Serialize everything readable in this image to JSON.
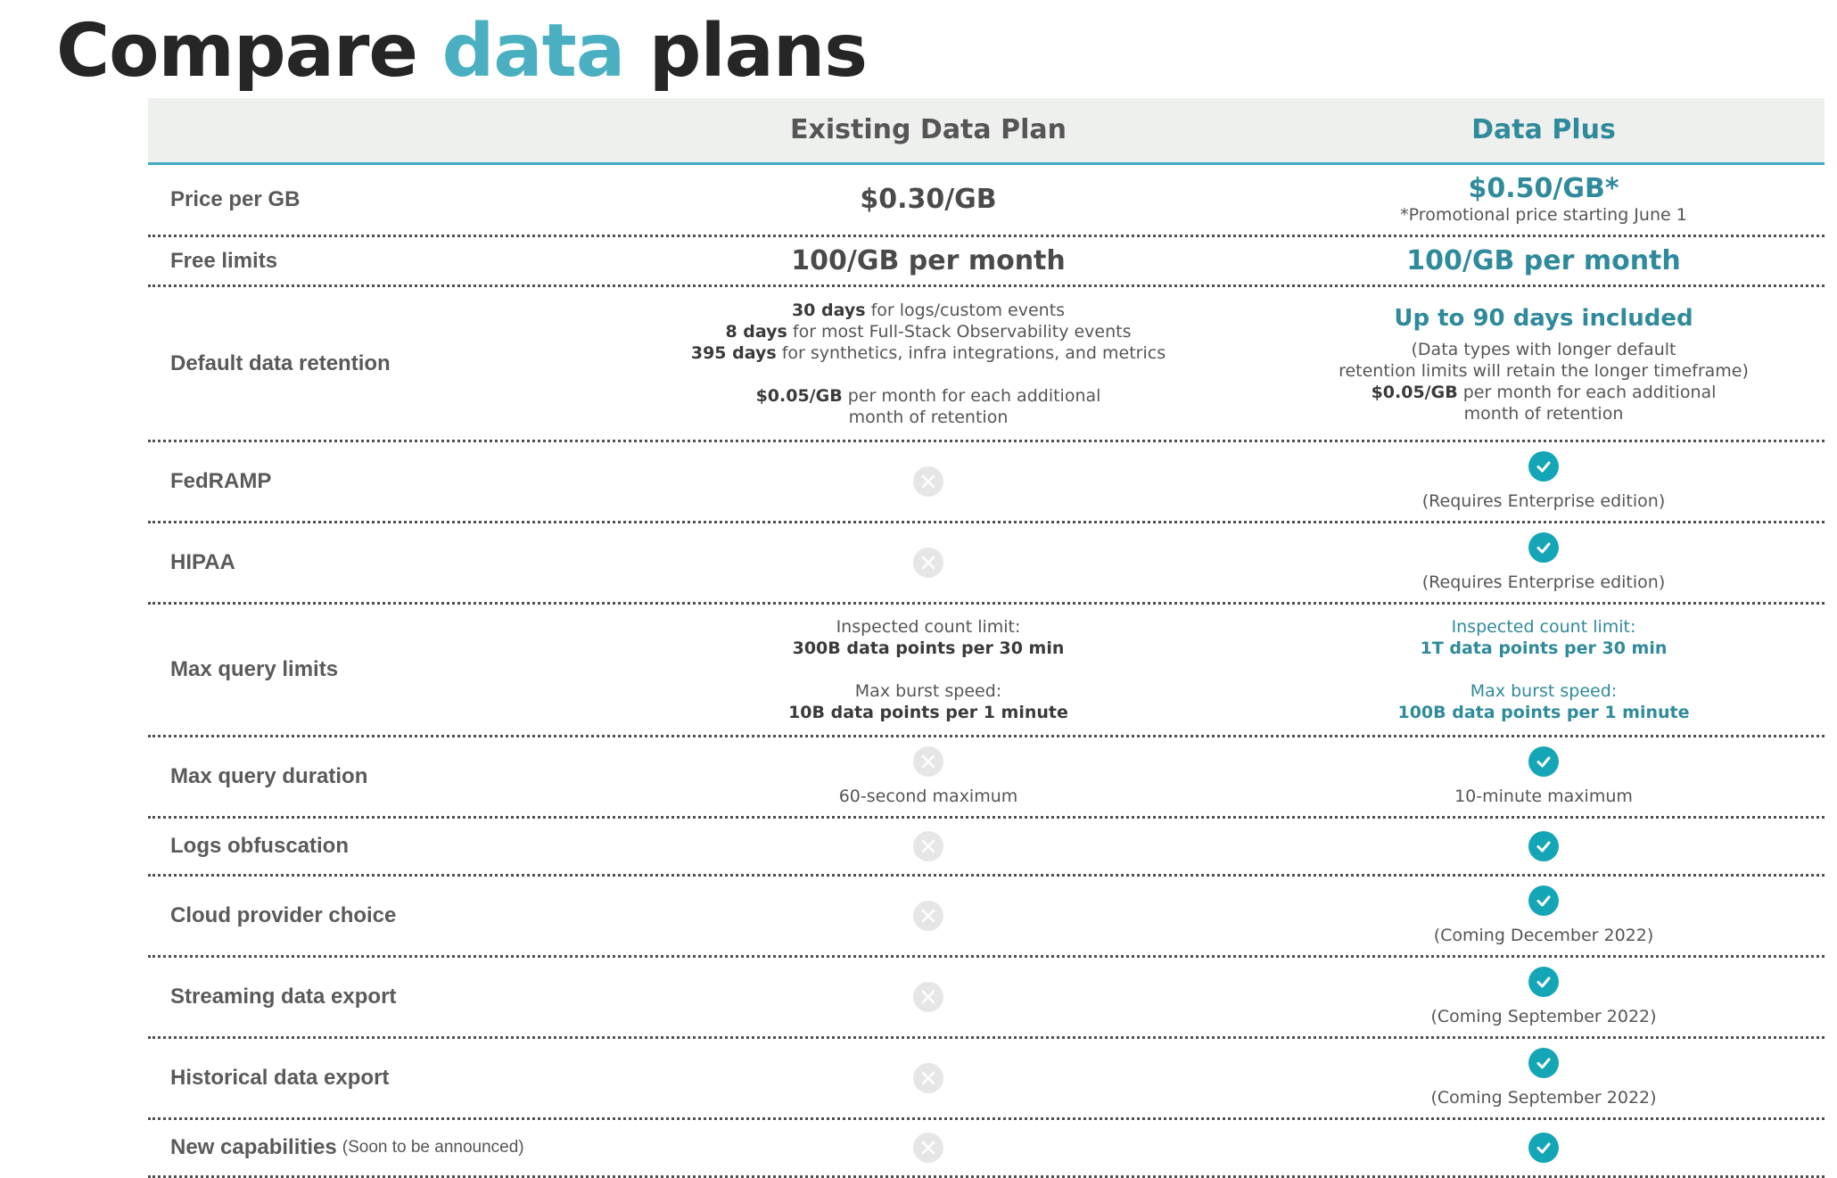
{
  "title": {
    "part1": "Compare",
    "part2": "data",
    "part3": "plans"
  },
  "colors": {
    "accent": "#4ab0c1",
    "teal_text": "#2f8a9b",
    "check": "#14a6b6",
    "cross_bg": "#e6e6e6",
    "header_bg": "#eef0ee"
  },
  "columns": {
    "existing": "Existing Data Plan",
    "plus": "Data Plus"
  },
  "rows": {
    "price": {
      "label": "Price per GB",
      "existing": "$0.30/GB",
      "plus": "$0.50/GB*",
      "plus_note": "*Promotional price starting June 1"
    },
    "free": {
      "label": "Free limits",
      "existing": "100/GB per month",
      "plus": "100/GB per month"
    },
    "retention": {
      "label": "Default data retention",
      "existing": {
        "l1_b": "30 days",
        "l1": " for logs/custom events",
        "l2_b": "8 days",
        "l2": " for most Full-Stack Observability events",
        "l3_b": "395 days",
        "l3": " for synthetics, infra integrations, and metrics",
        "p1_b": "$0.05/GB",
        "p1": " per month for each additional",
        "p2": "month of retention"
      },
      "plus": {
        "headline": "Up to 90 days included",
        "n1": "(Data types with longer default",
        "n2": "retention limits will retain the longer timeframe)",
        "p1_b": "$0.05/GB",
        "p1": " per month for each additional",
        "p2": "month of retention"
      }
    },
    "fedramp": {
      "label": "FedRAMP",
      "existing_icon": "x-icon",
      "plus_icon": "check-icon",
      "plus_note": "(Requires Enterprise edition)"
    },
    "hipaa": {
      "label": "HIPAA",
      "existing_icon": "x-icon",
      "plus_icon": "check-icon",
      "plus_note": "(Requires Enterprise edition)"
    },
    "query_limits": {
      "label": "Max query limits",
      "existing": {
        "a1": "Inspected count limit:",
        "a2": "300B data points per 30 min",
        "b1": "Max burst speed:",
        "b2": "10B data points per 1 minute"
      },
      "plus": {
        "a1": "Inspected count limit:",
        "a2": "1T data points per 30 min",
        "b1": "Max burst speed:",
        "b2": "100B data points per 1 minute"
      }
    },
    "query_duration": {
      "label": "Max query duration",
      "existing_icon": "x-icon",
      "existing_note": "60-second maximum",
      "plus_icon": "check-icon",
      "plus_note": "10-minute maximum"
    },
    "logs": {
      "label": "Logs obfuscation",
      "existing_icon": "x-icon",
      "plus_icon": "check-icon"
    },
    "cloud": {
      "label": "Cloud provider choice",
      "existing_icon": "x-icon",
      "plus_icon": "check-icon",
      "plus_note": "(Coming December 2022)"
    },
    "streaming": {
      "label": "Streaming data export",
      "existing_icon": "x-icon",
      "plus_icon": "check-icon",
      "plus_note": "(Coming September 2022)"
    },
    "historical": {
      "label": "Historical data export",
      "existing_icon": "x-icon",
      "plus_icon": "check-icon",
      "plus_note": "(Coming September 2022)"
    },
    "new_caps": {
      "label": "New capabilities",
      "label_note": "(Soon to be announced)",
      "existing_icon": "x-icon",
      "plus_icon": "check-icon"
    }
  }
}
